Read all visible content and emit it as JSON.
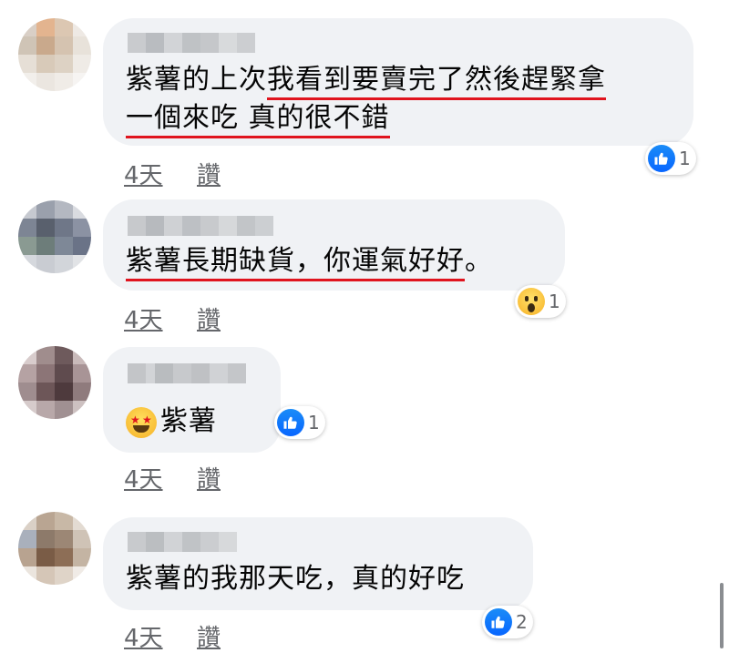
{
  "comments": [
    {
      "lines": [
        {
          "plain": "紫薯的上次",
          "underlined": "我看到要賣完了然後趕緊拿"
        },
        {
          "plain": "",
          "underlined": "一個來吃 真的很不錯"
        }
      ],
      "time": "4天",
      "like_label": "讚",
      "reaction": {
        "icon": "like-icon",
        "count": "1"
      }
    },
    {
      "lines": [
        {
          "plain": "",
          "underlined": "紫薯長期缺貨，你運氣好好",
          "after": "。"
        }
      ],
      "time": "4天",
      "like_label": "讚",
      "reaction": {
        "icon": "wow-icon",
        "count": "1"
      }
    },
    {
      "lines": [
        {
          "emoji": "star-struck-emoji",
          "plain": "紫薯"
        }
      ],
      "time": "4天",
      "like_label": "讚",
      "reaction": {
        "icon": "like-icon",
        "count": "1"
      }
    },
    {
      "lines": [
        {
          "plain": "紫薯的我那天吃，真的好吃"
        }
      ],
      "time": "4天",
      "like_label": "讚",
      "reaction": {
        "icon": "like-icon",
        "count": "2"
      }
    }
  ],
  "colors": {
    "underline": "#e0141e",
    "like_blue": "#0866ff",
    "bubble": "#f0f2f5",
    "meta": "#65676b"
  }
}
